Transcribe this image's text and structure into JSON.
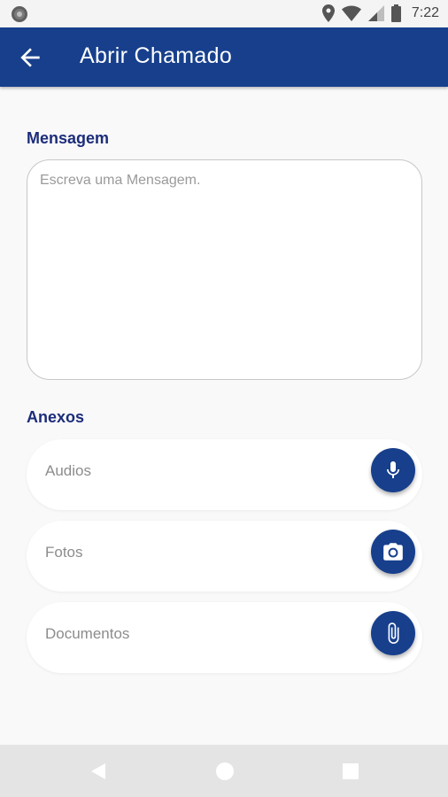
{
  "status_bar": {
    "time": "7:22"
  },
  "app_bar": {
    "title": "Abrir Chamado"
  },
  "message": {
    "label": "Mensagem",
    "placeholder": "Escreva uma Mensagem."
  },
  "attachments": {
    "label": "Anexos",
    "items": [
      {
        "label": "Audios",
        "icon": "microphone-icon"
      },
      {
        "label": "Fotos",
        "icon": "camera-icon"
      },
      {
        "label": "Documentos",
        "icon": "paperclip-icon"
      }
    ]
  },
  "colors": {
    "primary": "#173f8c",
    "section_label": "#1c2d7a",
    "placeholder": "#9a9a9a"
  }
}
